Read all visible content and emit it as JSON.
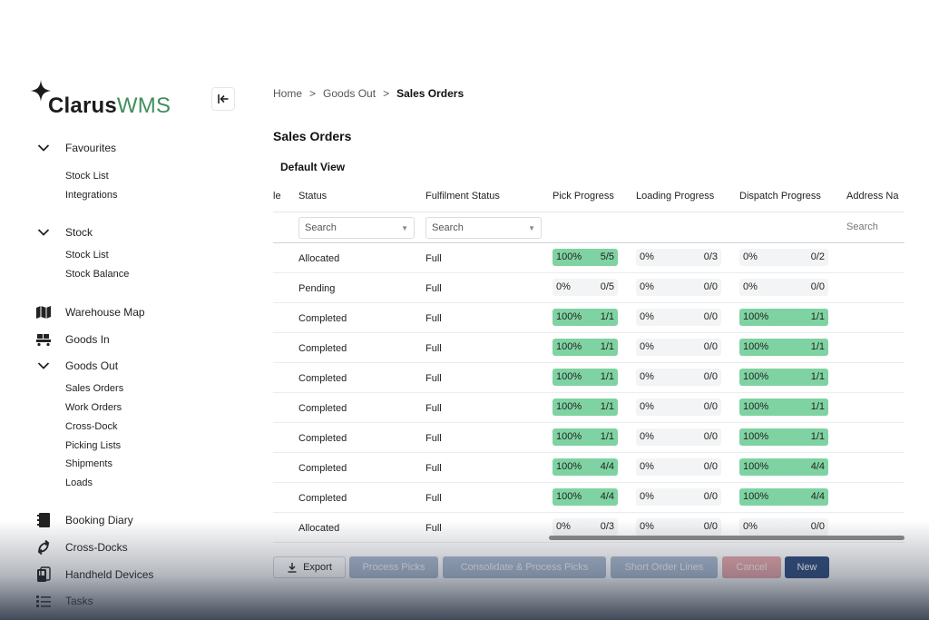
{
  "app": {
    "logo_main": "Clarus",
    "logo_accent": "WMS"
  },
  "sidebar": {
    "favourites": {
      "label": "Favourites",
      "items": [
        "Stock List",
        "Integrations"
      ]
    },
    "stock": {
      "label": "Stock",
      "items": [
        "Stock List",
        "Stock Balance"
      ]
    },
    "warehouse_map": "Warehouse Map",
    "goods_in": "Goods In",
    "goods_out": {
      "label": "Goods Out",
      "items": [
        "Sales Orders",
        "Work Orders",
        "Cross-Dock",
        "Picking Lists",
        "Shipments",
        "Loads"
      ]
    },
    "booking_diary": "Booking Diary",
    "cross_docks": "Cross-Docks",
    "handheld_devices": "Handheld Devices",
    "tasks": "Tasks"
  },
  "breadcrumb": {
    "home": "Home",
    "sep": ">",
    "section": "Goods Out",
    "current": "Sales Orders"
  },
  "page": {
    "title": "Sales Orders",
    "view": "Default View"
  },
  "table": {
    "columns": {
      "partial": "le",
      "status": "Status",
      "fulfilment": "Fulfilment Status",
      "pick": "Pick Progress",
      "loading": "Loading Progress",
      "dispatch": "Dispatch Progress",
      "address": "Address Na"
    },
    "filters": {
      "status": "Search",
      "fulfilment": "Search",
      "address": "Search"
    },
    "rows": [
      {
        "status": "Allocated",
        "fulfilment": "Full",
        "pick": {
          "pct": "100%",
          "count": "5/5",
          "fill": 1
        },
        "loading": {
          "pct": "0%",
          "count": "0/3",
          "fill": 0
        },
        "dispatch": {
          "pct": "0%",
          "count": "0/2",
          "fill": 0
        }
      },
      {
        "status": "Pending",
        "fulfilment": "Full",
        "pick": {
          "pct": "0%",
          "count": "0/5",
          "fill": 0
        },
        "loading": {
          "pct": "0%",
          "count": "0/0",
          "fill": 0
        },
        "dispatch": {
          "pct": "0%",
          "count": "0/0",
          "fill": 0
        }
      },
      {
        "status": "Completed",
        "fulfilment": "Full",
        "pick": {
          "pct": "100%",
          "count": "1/1",
          "fill": 1
        },
        "loading": {
          "pct": "0%",
          "count": "0/0",
          "fill": 0
        },
        "dispatch": {
          "pct": "100%",
          "count": "1/1",
          "fill": 1
        }
      },
      {
        "status": "Completed",
        "fulfilment": "Full",
        "pick": {
          "pct": "100%",
          "count": "1/1",
          "fill": 1
        },
        "loading": {
          "pct": "0%",
          "count": "0/0",
          "fill": 0
        },
        "dispatch": {
          "pct": "100%",
          "count": "1/1",
          "fill": 1
        }
      },
      {
        "status": "Completed",
        "fulfilment": "Full",
        "pick": {
          "pct": "100%",
          "count": "1/1",
          "fill": 1
        },
        "loading": {
          "pct": "0%",
          "count": "0/0",
          "fill": 0
        },
        "dispatch": {
          "pct": "100%",
          "count": "1/1",
          "fill": 1
        }
      },
      {
        "status": "Completed",
        "fulfilment": "Full",
        "pick": {
          "pct": "100%",
          "count": "1/1",
          "fill": 1
        },
        "loading": {
          "pct": "0%",
          "count": "0/0",
          "fill": 0
        },
        "dispatch": {
          "pct": "100%",
          "count": "1/1",
          "fill": 1
        }
      },
      {
        "status": "Completed",
        "fulfilment": "Full",
        "pick": {
          "pct": "100%",
          "count": "1/1",
          "fill": 1
        },
        "loading": {
          "pct": "0%",
          "count": "0/0",
          "fill": 0
        },
        "dispatch": {
          "pct": "100%",
          "count": "1/1",
          "fill": 1
        }
      },
      {
        "status": "Completed",
        "fulfilment": "Full",
        "pick": {
          "pct": "100%",
          "count": "4/4",
          "fill": 1
        },
        "loading": {
          "pct": "0%",
          "count": "0/0",
          "fill": 0
        },
        "dispatch": {
          "pct": "100%",
          "count": "4/4",
          "fill": 1
        }
      },
      {
        "status": "Completed",
        "fulfilment": "Full",
        "pick": {
          "pct": "100%",
          "count": "4/4",
          "fill": 1
        },
        "loading": {
          "pct": "0%",
          "count": "0/0",
          "fill": 0
        },
        "dispatch": {
          "pct": "100%",
          "count": "4/4",
          "fill": 1
        }
      },
      {
        "status": "Allocated",
        "fulfilment": "Full",
        "pick": {
          "pct": "0%",
          "count": "0/3",
          "fill": 0
        },
        "loading": {
          "pct": "0%",
          "count": "0/0",
          "fill": 0
        },
        "dispatch": {
          "pct": "0%",
          "count": "0/0",
          "fill": 0
        }
      }
    ]
  },
  "actions": {
    "export": "Export",
    "process_picks": "Process Picks",
    "consolidate": "Consolidate & Process Picks",
    "short_lines": "Short Order Lines",
    "cancel": "Cancel",
    "new": "New"
  },
  "colors": {
    "accent_green": "#3f8f5c",
    "progress_fill": "#7fd3a2",
    "primary": "#2d4a7d",
    "disabled": "#a9b8cf",
    "danger_disabled": "#e7a6aa"
  },
  "icons": [
    "star-icon",
    "collapse-left-icon",
    "chevron-down-icon",
    "map-icon",
    "goods-in-icon",
    "booking-diary-icon",
    "cross-docks-icon",
    "handheld-device-icon",
    "tasks-icon",
    "download-icon",
    "caret-down-icon"
  ]
}
